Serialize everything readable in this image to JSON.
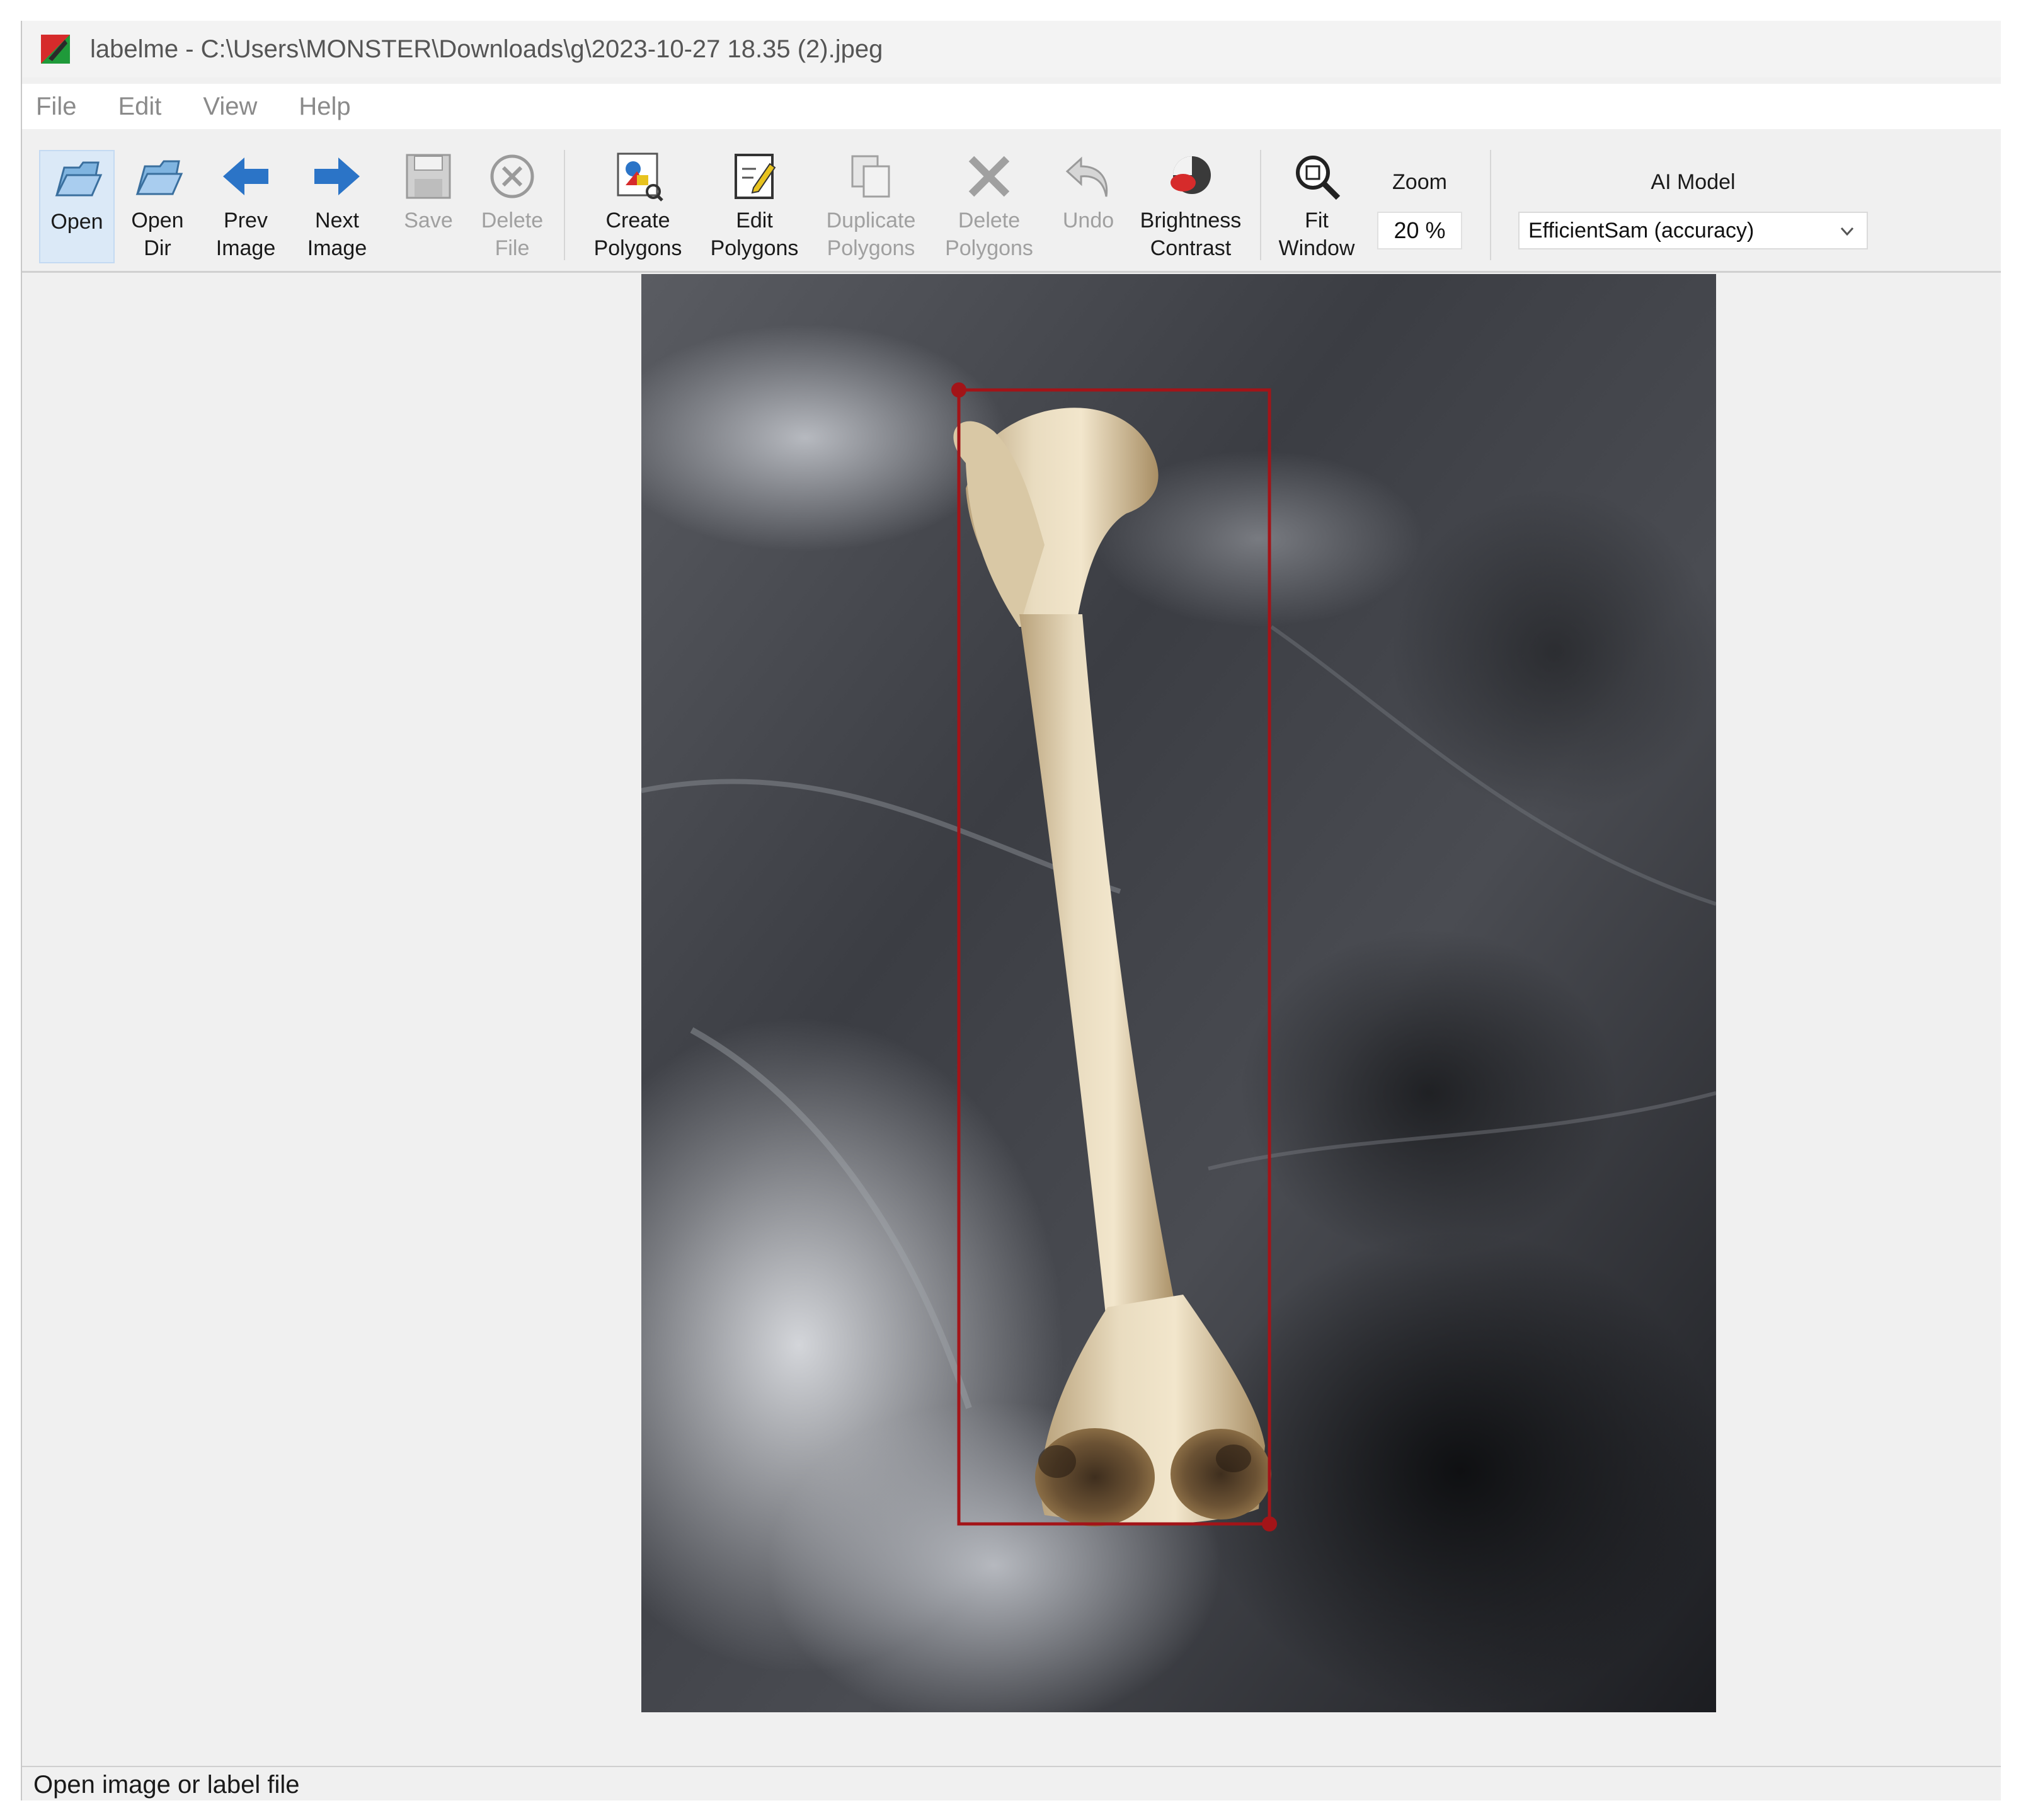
{
  "window": {
    "title": "labelme - C:\\Users\\MONSTER\\Downloads\\g\\2023-10-27 18.35 (2).jpeg"
  },
  "menu": {
    "items": [
      {
        "label": "File"
      },
      {
        "label": "Edit"
      },
      {
        "label": "View"
      },
      {
        "label": "Help"
      }
    ]
  },
  "toolbar": {
    "open": "Open",
    "open_dir": "Open\nDir",
    "prev_image": "Prev\nImage",
    "next_image": "Next\nImage",
    "save": "Save",
    "delete_file": "Delete\nFile",
    "create_polygons": "Create\nPolygons",
    "edit_polygons": "Edit\nPolygons",
    "duplicate_polygons": "Duplicate\nPolygons",
    "delete_polygons": "Delete\nPolygons",
    "undo": "Undo",
    "brightness_contrast": "Brightness\nContrast",
    "fit_window": "Fit\nWindow",
    "zoom_label": "Zoom",
    "zoom_value": "20 %",
    "ai_model_label": "AI Model",
    "ai_model_value": "EfficientSam (accuracy)"
  },
  "icons": {
    "app": "labelme-app-icon",
    "open": "folder-open-icon",
    "open_dir": "folder-open-icon",
    "prev": "arrow-left-icon",
    "next": "arrow-right-icon",
    "save": "floppy-icon",
    "delete_file": "circle-x-icon",
    "create": "polygon-create-icon",
    "edit": "polygon-edit-icon",
    "duplicate": "copy-icon",
    "delete_polygons": "x-cross-icon",
    "undo": "undo-arrow-icon",
    "brightness": "brightness-icon",
    "fit": "magnifier-icon",
    "dropdown": "chevron-down-icon"
  },
  "colors": {
    "annotation_box": "#a31418",
    "arrow_blue": "#2b74c7",
    "active_tool": "#dbe9f7",
    "disabled_text": "#a0a0a0"
  },
  "status": {
    "text": "Open image or label file"
  }
}
